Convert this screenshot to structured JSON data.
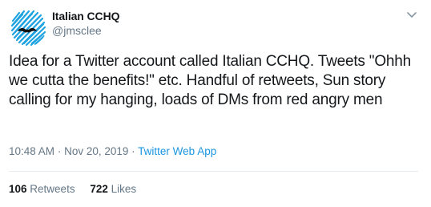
{
  "author": {
    "display_name": "Italian CCHQ",
    "handle": "@jmsclee",
    "avatar_icon": "scribble-moustache-avatar-icon"
  },
  "menu": {
    "icon": "chevron-down-icon"
  },
  "tweet": {
    "text": "Idea for a Twitter account called Italian CCHQ. Tweets \"Ohhh we cutta the benefits!\" etc. Handful of retweets, Sun story calling for my hanging, loads of DMs from red angry men",
    "time": "10:48 AM",
    "separator": "·",
    "date": "Nov 20, 2019",
    "app": "Twitter Web App"
  },
  "stats": {
    "retweets_count": "106",
    "retweets_label": "Retweets",
    "likes_count": "722",
    "likes_label": "Likes"
  },
  "colors": {
    "text": "#14171a",
    "muted": "#657786",
    "link": "#1b95e0",
    "avatar_blue": "#1fa3e0",
    "divider": "#e6ecf0"
  }
}
